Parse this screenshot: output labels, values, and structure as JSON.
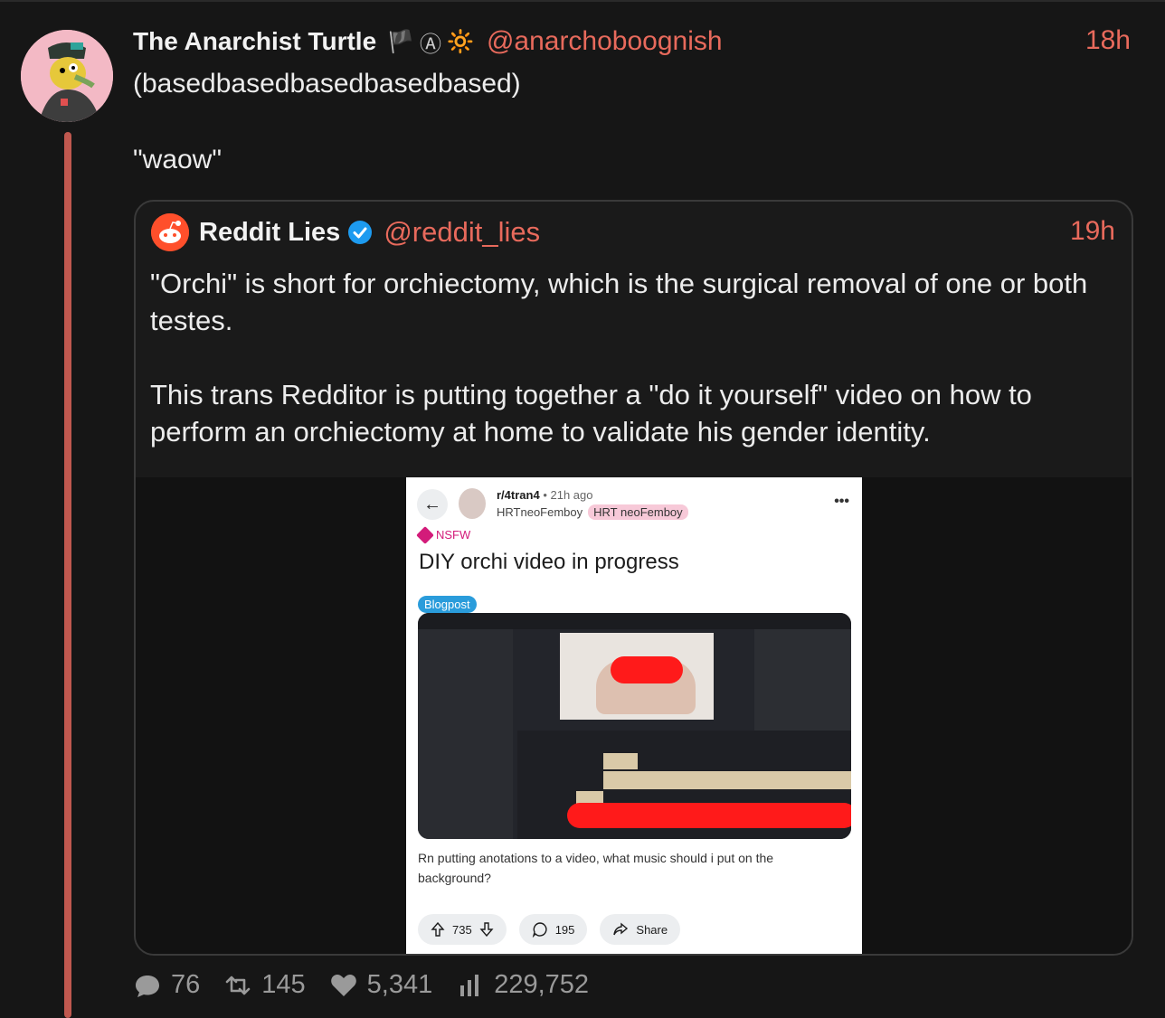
{
  "post": {
    "author_name": "The Anarchist Turtle",
    "author_flags": [
      "🏴",
      "Ⓐ",
      "🔆"
    ],
    "author_handle": "@anarchoboognish",
    "time": "18h",
    "bio": "(basedbasedbasedbasedbased)",
    "text": "\"waow\""
  },
  "quote": {
    "author_name": "Reddit Lies",
    "author_handle": "@reddit_lies",
    "time": "19h",
    "paragraphs": [
      "\"Orchi\" is short for orchiectomy, which is the surgical removal of one or both testes.",
      "This trans Redditor is putting together a \"do it yourself\" video on how to perform an orchiectomy at home to validate his gender identity."
    ],
    "screenshot": {
      "subreddit": "r/4tran4",
      "ago": "• 21h ago",
      "username": "HRTneoFemboy",
      "flair": "HRT neoFemboy",
      "nsfw": "NSFW",
      "title": "DIY orchi video in progress",
      "tag": "Blogpost",
      "body": "Rn putting anotations to a video, what music should i put on the background?",
      "upvotes": "735",
      "comments": "195",
      "share": "Share"
    }
  },
  "stats": {
    "replies": "76",
    "reposts": "145",
    "likes": "5,341",
    "views": "229,752"
  },
  "colors": {
    "accent": "#e86a5c",
    "thread": "#c0584f",
    "background": "#161616"
  }
}
